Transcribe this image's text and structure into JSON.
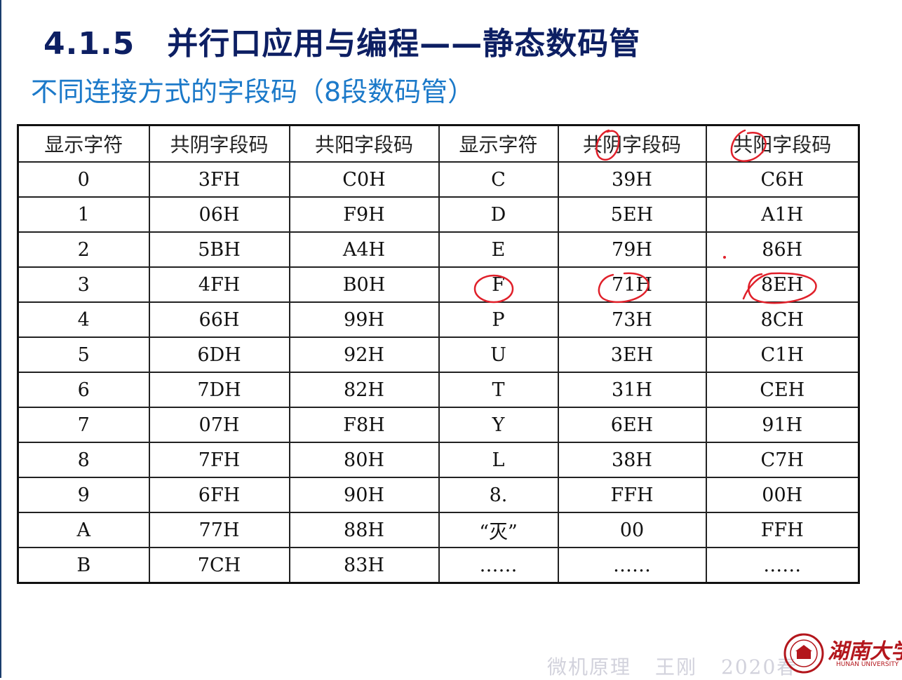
{
  "slide": {
    "title_number": "4.1.5",
    "title_text": "并行口应用与编程——静态数码管",
    "subtitle": "不同连接方式的字段码（8段数码管）"
  },
  "table": {
    "headers": [
      "显示字符",
      "共阴字段码",
      "共阳字段码",
      "显示字符",
      "共阴字段码",
      "共阳字段码"
    ],
    "rows": [
      [
        "0",
        "3FH",
        "C0H",
        "C",
        "39H",
        "C6H"
      ],
      [
        "1",
        "06H",
        "F9H",
        "D",
        "5EH",
        "A1H"
      ],
      [
        "2",
        "5BH",
        "A4H",
        "E",
        "79H",
        "86H"
      ],
      [
        "3",
        "4FH",
        "B0H",
        "F",
        "71H",
        "8EH"
      ],
      [
        "4",
        "66H",
        "99H",
        "P",
        "73H",
        "8CH"
      ],
      [
        "5",
        "6DH",
        "92H",
        "U",
        "3EH",
        "C1H"
      ],
      [
        "6",
        "7DH",
        "82H",
        "T",
        "31H",
        "CEH"
      ],
      [
        "7",
        "07H",
        "F8H",
        "Y",
        "6EH",
        "91H"
      ],
      [
        "8",
        "7FH",
        "80H",
        "L",
        "38H",
        "C7H"
      ],
      [
        "9",
        "6FH",
        "90H",
        "8.",
        "FFH",
        "00H"
      ],
      [
        "A",
        "77H",
        "88H",
        "“灭”",
        "00",
        "FFH"
      ],
      [
        "B",
        "7CH",
        "83H",
        "……",
        "……",
        "……"
      ]
    ]
  },
  "footer": {
    "course": "微机原理",
    "teacher": "王刚",
    "term": "2020春"
  },
  "logo": {
    "name": "湖南大学",
    "english": "HUNAN UNIVERSITY",
    "icon": "university-seal-icon"
  },
  "colors": {
    "title": "#0d1f63",
    "subtitle": "#1b79c9",
    "annotation": "#e0202a",
    "logo": "#b3161c"
  }
}
